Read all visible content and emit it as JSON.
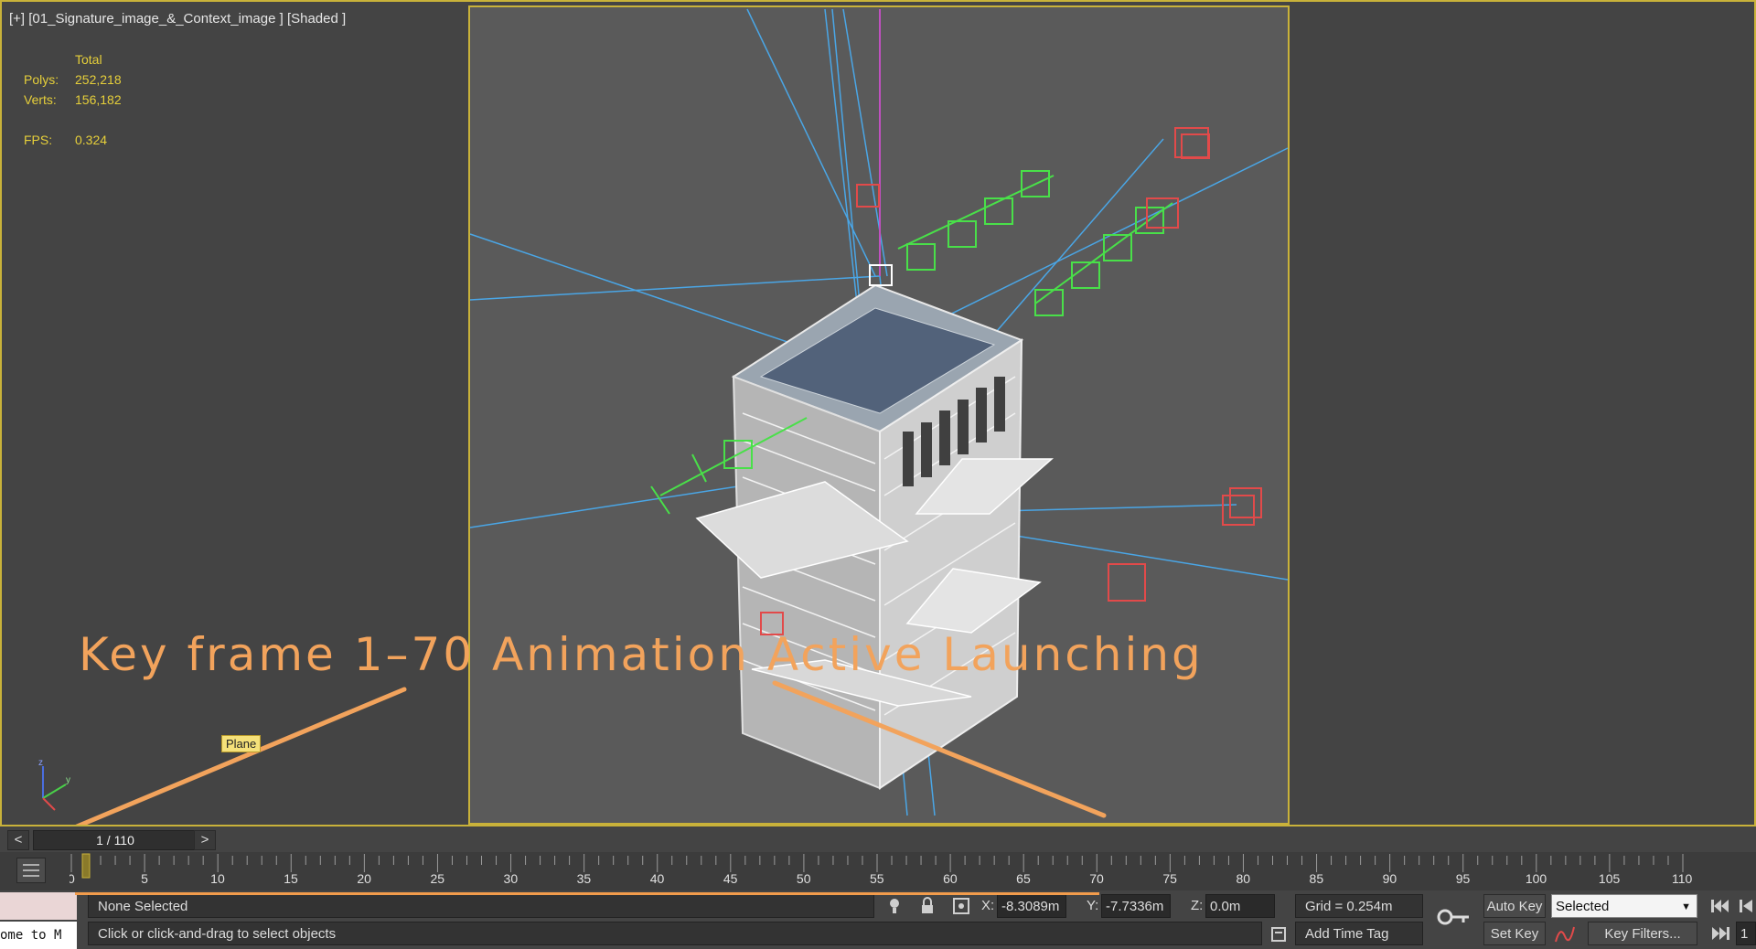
{
  "viewport": {
    "label": "[+] [01_Signature_image_&_Context_image ] [Shaded ]",
    "stats": {
      "header": "Total",
      "polys_label": "Polys:",
      "polys_value": "252,218",
      "verts_label": "Verts:",
      "verts_value": "156,182",
      "fps_label": "FPS:",
      "fps_value": "0.324"
    },
    "annotation": "Key frame 1–70 Animation Active Launching",
    "object_tag": "Plane"
  },
  "time_slider": {
    "prev": "<",
    "position": "1 / 110",
    "next": ">"
  },
  "track_bar": {
    "ticks": [
      "0",
      "5",
      "10",
      "15",
      "20",
      "25",
      "30",
      "35",
      "40",
      "45",
      "50",
      "55",
      "60",
      "65",
      "70",
      "75",
      "80",
      "85",
      "90",
      "95",
      "100",
      "105",
      "110"
    ],
    "current_frame": 1,
    "total_frames": 110
  },
  "status": {
    "selection": "None Selected",
    "prompt": "Click or click-and-drag to select objects",
    "x_label": "X:",
    "x_value": "-8.3089m",
    "y_label": "Y:",
    "y_value": "-7.7336m",
    "z_label": "Z:",
    "z_value": "0.0m",
    "grid": "Grid = 0.254m",
    "add_time_tag": "Add Time Tag",
    "maxscript": "ome to M"
  },
  "animation_controls": {
    "auto_key": "Auto Key",
    "set_key": "Set Key",
    "selected_option": "Selected",
    "key_filters": "Key Filters...",
    "frame_field": "1"
  },
  "colors": {
    "viewport_border": "#c9b23a",
    "annotation": "#f2a35c",
    "stats_text": "#e6cf3a",
    "camera_lines": "#4aa6e6",
    "green_helpers": "#49e049",
    "red_helpers": "#e24a4a"
  }
}
